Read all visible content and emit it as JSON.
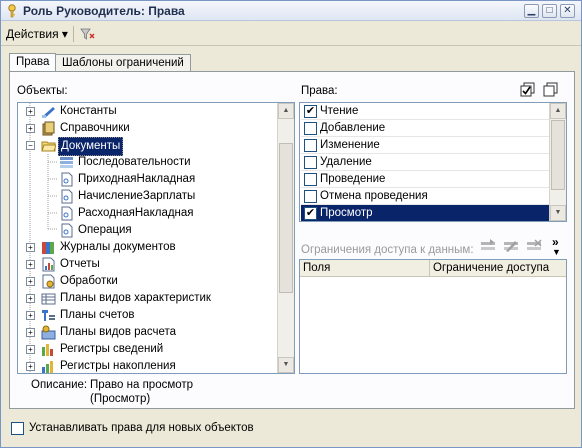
{
  "window": {
    "title": "Роль Руководитель: Права"
  },
  "toolbar": {
    "actions_label": "Действия",
    "actions_arrow": "▾"
  },
  "tabs": [
    {
      "label": "Права",
      "active": true
    },
    {
      "label": "Шаблоны ограничений",
      "active": false
    }
  ],
  "objects": {
    "label": "Объекты:",
    "tree": [
      {
        "label": "Константы",
        "icon": "constants-icon",
        "expander": "+"
      },
      {
        "label": "Справочники",
        "icon": "catalogs-icon",
        "expander": "+"
      },
      {
        "label": "Документы",
        "icon": "documents-icon",
        "expander": "−",
        "selected": true
      },
      {
        "label": "Последовательности",
        "icon": "sequences-icon",
        "child": true
      },
      {
        "label": "ПриходнаяНакладная",
        "icon": "document-icon",
        "child": true
      },
      {
        "label": "НачислениеЗарплаты",
        "icon": "document-icon",
        "child": true
      },
      {
        "label": "РасходнаяНакладная",
        "icon": "document-icon",
        "child": true
      },
      {
        "label": "Операция",
        "icon": "document-icon",
        "child": true
      },
      {
        "label": "Журналы документов",
        "icon": "journals-icon",
        "expander": "+"
      },
      {
        "label": "Отчеты",
        "icon": "reports-icon",
        "expander": "+"
      },
      {
        "label": "Обработки",
        "icon": "dataprocessors-icon",
        "expander": "+"
      },
      {
        "label": "Планы видов характеристик",
        "icon": "chart-of-characteristic-types-icon",
        "expander": "+"
      },
      {
        "label": "Планы счетов",
        "icon": "chart-of-accounts-icon",
        "expander": "+"
      },
      {
        "label": "Планы видов расчета",
        "icon": "chart-of-calculation-types-icon",
        "expander": "+"
      },
      {
        "label": "Регистры сведений",
        "icon": "information-registers-icon",
        "expander": "+"
      },
      {
        "label": "Регистры накопления",
        "icon": "accumulation-registers-icon",
        "expander": "+"
      }
    ]
  },
  "rights": {
    "label": "Права:",
    "items": [
      {
        "label": "Чтение",
        "checked": true
      },
      {
        "label": "Добавление",
        "checked": false
      },
      {
        "label": "Изменение",
        "checked": false
      },
      {
        "label": "Удаление",
        "checked": false
      },
      {
        "label": "Проведение",
        "checked": false
      },
      {
        "label": "Отмена проведения",
        "checked": false
      },
      {
        "label": "Просмотр",
        "checked": true,
        "selected": true
      }
    ]
  },
  "restrictions": {
    "label": "Ограничения доступа к данным:",
    "columns": [
      "Поля",
      "Ограничение доступа"
    ],
    "more": "»"
  },
  "description": {
    "label": "Описание:",
    "line1": "Право на просмотр",
    "line2": "(Просмотр)"
  },
  "footer": {
    "set_rights_new_objects": "Устанавливать права для новых объектов"
  },
  "colors": {
    "selection": "#0a246a",
    "title_text": "#1f2f4f"
  }
}
